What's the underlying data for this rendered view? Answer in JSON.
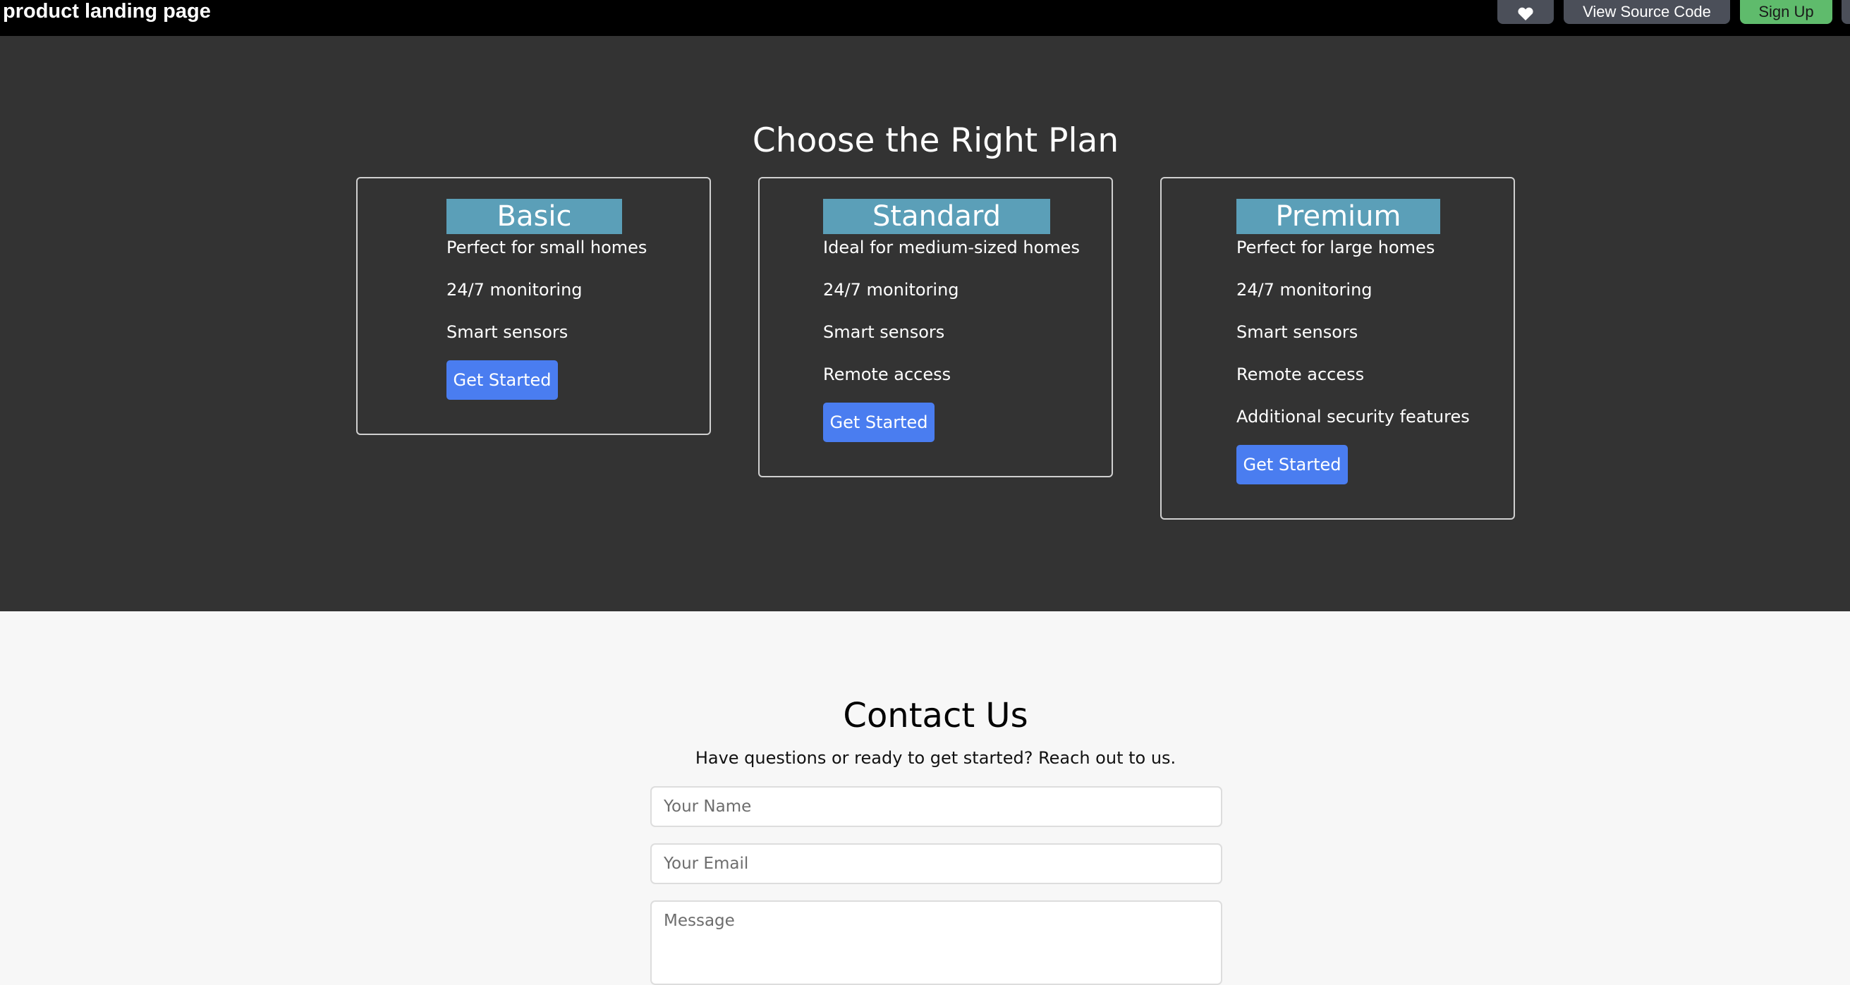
{
  "header": {
    "app_title": "product landing page",
    "buttons": {
      "view_source": "View Source Code",
      "sign_up": "Sign Up"
    }
  },
  "pricing": {
    "title": "Choose the Right Plan",
    "plans": [
      {
        "name": "Basic",
        "features": [
          "Perfect for small homes",
          "24/7 monitoring",
          "Smart sensors"
        ],
        "cta": "Get Started"
      },
      {
        "name": "Standard",
        "features": [
          "Ideal for medium-sized homes",
          "24/7 monitoring",
          "Smart sensors",
          "Remote access"
        ],
        "cta": "Get Started"
      },
      {
        "name": "Premium",
        "features": [
          "Perfect for large homes",
          "24/7 monitoring",
          "Smart sensors",
          "Remote access",
          "Additional security features"
        ],
        "cta": "Get Started"
      }
    ]
  },
  "contact": {
    "title": "Contact Us",
    "subtitle": "Have questions or ready to get started? Reach out to us.",
    "fields": {
      "name_placeholder": "Your Name",
      "email_placeholder": "Your Email",
      "message_placeholder": "Message"
    }
  },
  "colors": {
    "topbar": "#000000",
    "pricing_bg": "#333333",
    "plan_header": "#5b9fb8",
    "cta_button": "#4a7df0",
    "sign_up_button": "#5fbb6c",
    "page_bg": "#f7f7f7"
  },
  "icons": {
    "favorite": "heart-icon"
  }
}
